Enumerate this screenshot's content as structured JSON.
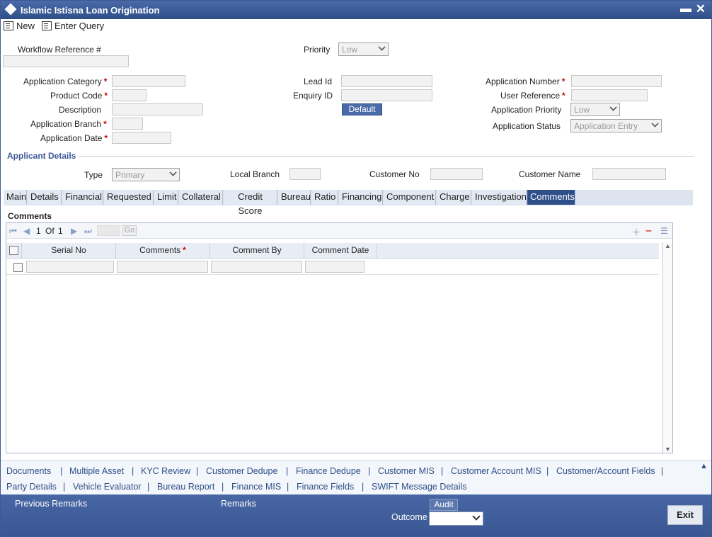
{
  "window": {
    "title": "Islamic Istisna Loan Origination"
  },
  "toolbar": {
    "new_label": "New",
    "enter_query_label": "Enter Query"
  },
  "header": {
    "workflow_ref_label": "Workflow Reference #",
    "priority_label": "Priority",
    "priority_value": "Low"
  },
  "form": {
    "app_category_label": "Application Category",
    "product_code_label": "Product Code",
    "description_label": "Description",
    "app_branch_label": "Application Branch",
    "app_date_label": "Application Date",
    "lead_id_label": "Lead Id",
    "enquiry_id_label": "Enquiry ID",
    "default_button": "Default",
    "app_number_label": "Application Number",
    "user_ref_label": "User Reference",
    "app_priority_label": "Application Priority",
    "app_priority_value": "Low",
    "app_status_label": "Application Status",
    "app_status_value": "Application Entry"
  },
  "applicant": {
    "section_title": "Applicant Details",
    "type_label": "Type",
    "type_value": "Primary",
    "local_branch_label": "Local Branch",
    "customer_no_label": "Customer No",
    "customer_name_label": "Customer Name"
  },
  "tabs": [
    "Main",
    "Details",
    "Financial",
    "Requested",
    "Limit",
    "Collateral",
    "Credit Score",
    "Bureau",
    "Ratio",
    "Financing",
    "Component",
    "Charge",
    "Investigation",
    "Comments"
  ],
  "comments": {
    "section_title": "Comments",
    "pager_current": "1",
    "pager_of": "Of",
    "pager_total": "1",
    "go_label": "Go",
    "columns": [
      "Serial No",
      "Comments",
      "Comment By",
      "Comment Date"
    ]
  },
  "links": {
    "row1": [
      "Documents",
      "Multiple Asset",
      "KYC Review",
      "Customer Dedupe",
      "Finance Dedupe",
      "Customer MIS",
      "Customer Account MIS",
      "Customer/Account Fields"
    ],
    "row2": [
      "Party Details",
      "Vehicle Evaluator",
      "Bureau Report",
      "Finance MIS",
      "Finance Fields",
      "SWIFT Message Details"
    ]
  },
  "footer": {
    "previous_remarks_label": "Previous Remarks",
    "remarks_label": "Remarks",
    "audit_label": "Audit",
    "outcome_label": "Outcome",
    "exit_label": "Exit"
  }
}
